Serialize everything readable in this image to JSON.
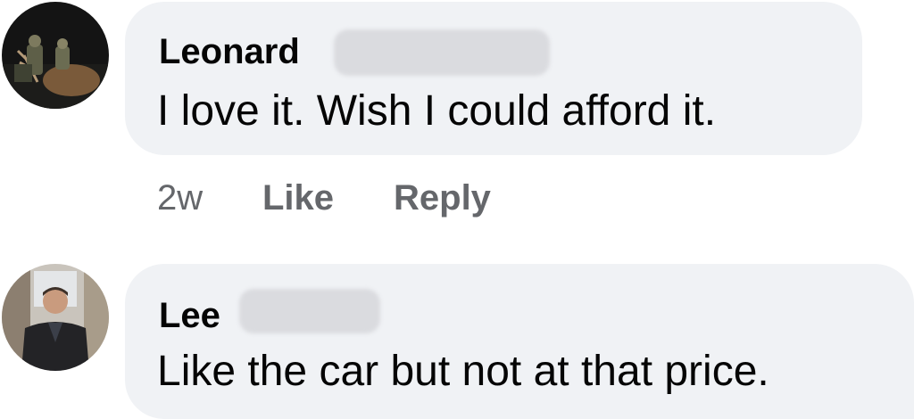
{
  "comments": [
    {
      "author": "Leonard",
      "text": "I love it.  Wish I could afford it.",
      "time": "2w",
      "like_label": "Like",
      "reply_label": "Reply",
      "avatar_icon": "hunter-photo-avatar"
    },
    {
      "author": "Lee",
      "text": "Like the car but not at that price.",
      "avatar_icon": "man-in-suit-photo-avatar"
    }
  ],
  "colors": {
    "bubble": "#f0f2f5",
    "text": "#050505",
    "meta": "#65676b"
  }
}
